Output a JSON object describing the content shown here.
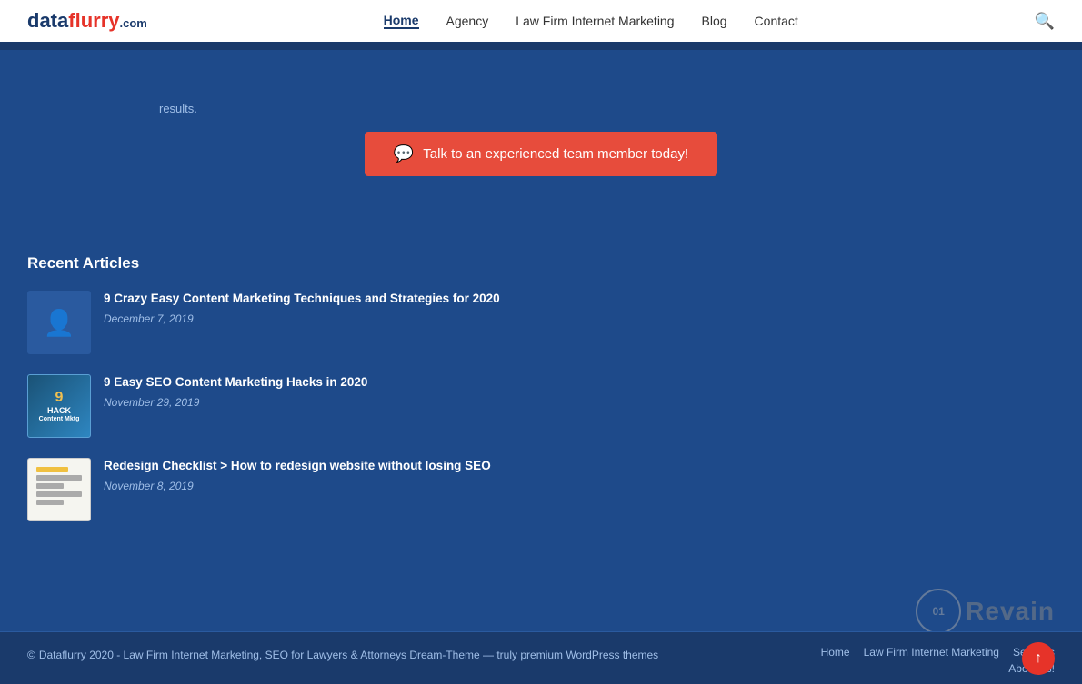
{
  "header": {
    "logo_text": "dataflurry",
    "logo_suffix": ".com",
    "nav": {
      "items": [
        {
          "label": "Home",
          "active": true
        },
        {
          "label": "Agency",
          "active": false
        },
        {
          "label": "Law Firm Internet Marketing",
          "active": false
        },
        {
          "label": "Blog",
          "active": false
        },
        {
          "label": "Contact",
          "active": false
        }
      ]
    }
  },
  "hero": {
    "body_text": "results.",
    "cta_label": "Talk to an experienced team member today!"
  },
  "recent_articles": {
    "section_title": "Recent Articles",
    "articles": [
      {
        "title": "9 Crazy Easy Content Marketing Techniques and Strategies for 2020",
        "date": "December 7, 2019",
        "thumb_type": "person"
      },
      {
        "title": "9 Easy SEO Content Marketing Hacks in 2020",
        "date": "November 29, 2019",
        "thumb_type": "seo"
      },
      {
        "title": "Redesign Checklist > How to redesign website without losing SEO",
        "date": "November 8, 2019",
        "thumb_type": "layout"
      }
    ]
  },
  "footer": {
    "copyright_text": "Dataflurry 2020 - Law Firm Internet Marketing, SEO for Lawyers & Attorneys Dream-Theme — truly premium WordPress themes",
    "links": [
      {
        "label": "Home"
      },
      {
        "label": "Law Firm Internet Marketing"
      },
      {
        "label": "Services"
      },
      {
        "label": "About us!"
      }
    ]
  }
}
